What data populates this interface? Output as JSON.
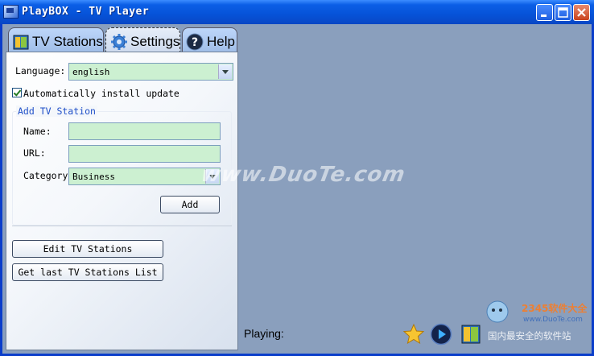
{
  "window": {
    "title": "PlayBOX - TV Player"
  },
  "tabs": [
    {
      "label": "TV Stations",
      "icon": "tv-stations-icon"
    },
    {
      "label": "Settings",
      "icon": "gear-icon",
      "active": true
    },
    {
      "label": "Help",
      "icon": "help-icon"
    }
  ],
  "settings": {
    "language_label": "Language:",
    "language_value": "english",
    "auto_update_label": "Automatically install update",
    "auto_update_checked": true,
    "group_title": "Add TV Station",
    "name_label": "Name:",
    "name_value": "",
    "url_label": "URL:",
    "url_value": "",
    "category_label": "Category:",
    "category_value": "Business",
    "add_button": "Add",
    "edit_button": "Edit TV Stations",
    "get_list_button": "Get last TV Stations List"
  },
  "player": {
    "playing_label": "Playing:"
  },
  "watermark": "www.DuoTe.com",
  "logo": {
    "text1": "2345软件大全",
    "text2": "国内最安全的软件站",
    "url": "www.DuoTe.com"
  },
  "colors": {
    "accent": "#0a3dca",
    "field_bg": "#ccf0d1",
    "video_bg": "#8a9fbd"
  }
}
